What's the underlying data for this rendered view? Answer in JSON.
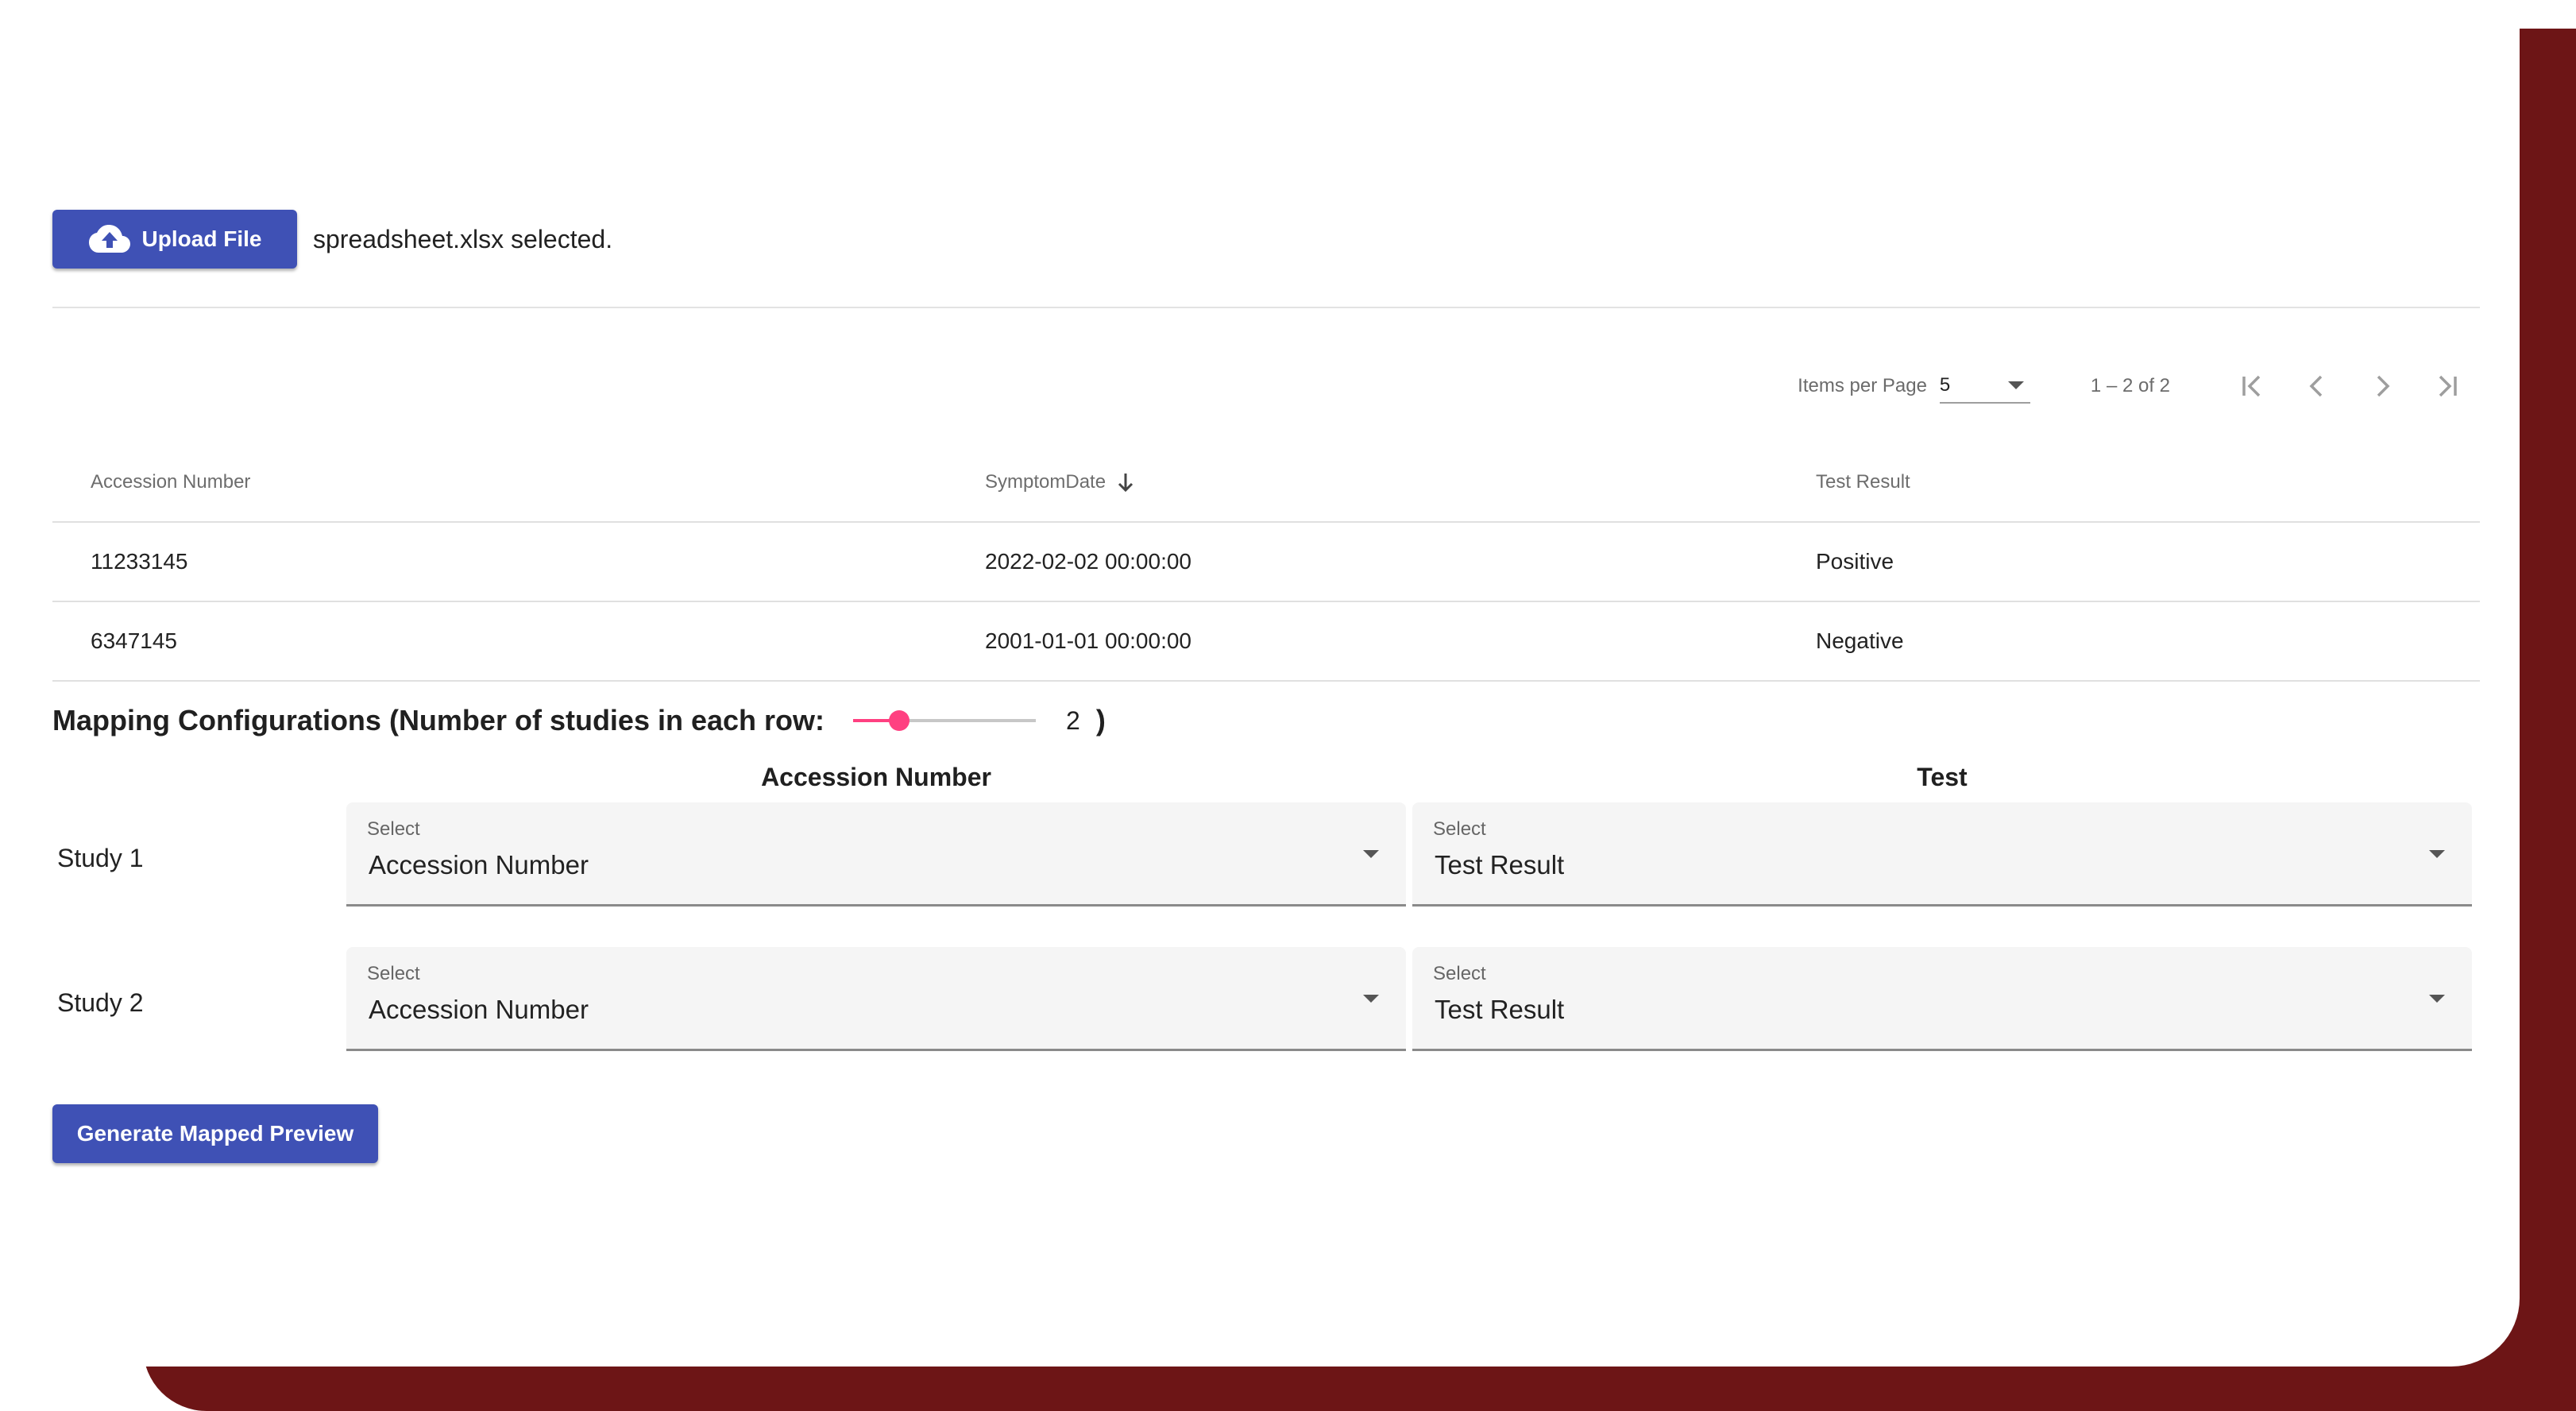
{
  "upload": {
    "button_label": "Upload File",
    "file_status": "spreadsheet.xlsx selected."
  },
  "paginator": {
    "items_per_page_label": "Items per Page",
    "items_per_page_value": "5",
    "range_label": "1 – 2 of 2"
  },
  "table": {
    "columns": [
      "Accession Number",
      "SymptomDate",
      "Test Result"
    ],
    "sorted_column": "SymptomDate",
    "sort_direction": "descending",
    "rows": [
      [
        "11233145",
        "2022-02-02 00:00:00",
        "Positive"
      ],
      [
        "6347145",
        "2001-01-01 00:00:00",
        "Negative"
      ]
    ]
  },
  "mapping": {
    "title": "Mapping Configurations (Number of studies in each row:",
    "slider_value": "2",
    "slider_fraction": 0.25,
    "closing_paren": ")",
    "column_headers": [
      "Accession Number",
      "Test"
    ],
    "studies": [
      {
        "label": "Study 1",
        "fields": [
          {
            "label": "Select",
            "value": "Accession Number"
          },
          {
            "label": "Select",
            "value": "Test Result"
          }
        ]
      },
      {
        "label": "Study 2",
        "fields": [
          {
            "label": "Select",
            "value": "Accession Number"
          },
          {
            "label": "Select",
            "value": "Test Result"
          }
        ]
      }
    ]
  },
  "generate_button_label": "Generate Mapped Preview",
  "colors": {
    "primary": "#3f51b5",
    "accent": "#ff4081",
    "backdrop": "#6d1516"
  }
}
